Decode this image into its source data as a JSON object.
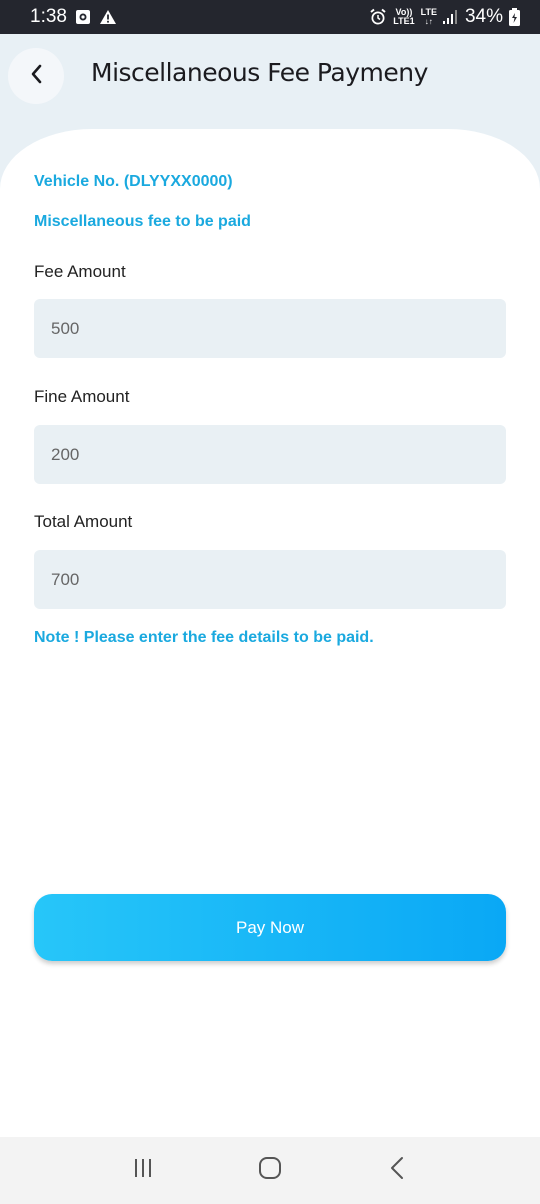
{
  "status": {
    "time": "1:38",
    "battery": "34%",
    "network_top": "LTE",
    "volte_top": "Vo))",
    "volte_bottom": "LTE1"
  },
  "header": {
    "title": "Miscellaneous Fee Paymeny"
  },
  "form": {
    "vehicle_no": "Vehicle No. (DLYYXX0000)",
    "subtitle": "Miscellaneous fee to be paid",
    "fee_label": "Fee Amount",
    "fee_value": "500",
    "fine_label": "Fine Amount",
    "fine_value": "200",
    "total_label": "Total Amount",
    "total_value": "700",
    "note": "Note ! Please enter the fee details to be paid."
  },
  "actions": {
    "pay_label": "Pay Now"
  },
  "icons": {
    "back": "chevron-left-icon",
    "recent": "recent-apps-icon",
    "home": "home-icon",
    "nav_back": "nav-back-icon"
  },
  "colors": {
    "accent": "#1aa9df",
    "button_start": "#27c6f9",
    "button_end": "#0aa8f5",
    "field_bg": "#e9f0f4",
    "header_bg": "#e8f0f5"
  }
}
